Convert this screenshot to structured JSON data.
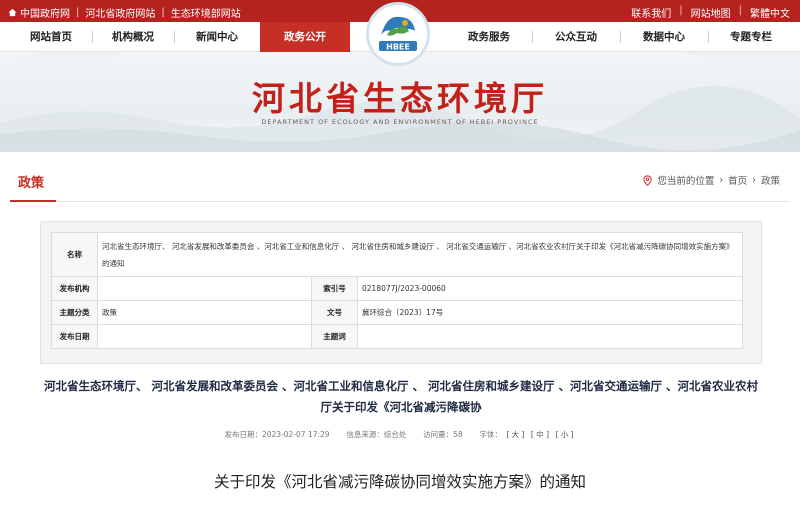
{
  "topbar": {
    "left_links": [
      "中国政府网",
      "河北省政府网站",
      "生态环境部网站"
    ],
    "right_links": [
      "联系我们",
      "网站地图",
      "繁體中文"
    ]
  },
  "nav": {
    "items": [
      "网站首页",
      "机构概况",
      "新闻中心",
      "政务公开",
      "政务服务",
      "公众互动",
      "数据中心",
      "专题专栏"
    ],
    "active": "政务公开"
  },
  "logo": {
    "text": "HBEE"
  },
  "banner": {
    "title": "河北省生态环境厅",
    "subtitle": "DEPARTMENT OF ECOLOGY AND ENVIRONMENT OF HEBEI PROVINCE"
  },
  "section": {
    "title": "政策",
    "crumb_prefix": "您当前的位置",
    "crumbs": [
      "首页",
      "政策"
    ]
  },
  "info": {
    "name_label": "名称",
    "name_value": "河北省生态环境厅、 河北省发展和改革委员会 、河北省工业和信息化厅 、 河北省住房和城乡建设厅 、 河北省交通运输厅 、河北省农业农村厅关于印发《河北省减污降碳协同增效实施方案》的通知",
    "publisher_label": "发布机构",
    "publisher_value": "",
    "index_label": "索引号",
    "index_value": "0218077J/2023-00060",
    "topic_label": "主题分类",
    "topic_value": "政策",
    "docno_label": "文号",
    "docno_value": "冀环综合〔2023〕17号",
    "date_label": "发布日期",
    "date_value": "",
    "keyword_label": "主题词",
    "keyword_value": ""
  },
  "article": {
    "headline": "河北省生态环境厅、 河北省发展和改革委员会 、河北省工业和信息化厅 、 河北省住房和城乡建设厅 、河北省交通运输厅 、河北省农业农村厅关于印发《河北省减污降碳协",
    "date_label": "发布日期：",
    "date": "2023-02-07 17:29",
    "source_label": "信息来源：",
    "source": "综合处",
    "views_label": "访问量：",
    "views": "58",
    "font_label": "字体：",
    "font_sizes": [
      "[ 大 ]",
      "[ 中 ]",
      "[ 小 ]"
    ],
    "doc_title": "关于印发《河北省减污降碳协同增效实施方案》的通知"
  },
  "colors": {
    "brand_red": "#c62f26",
    "topbar_red": "#b5231f",
    "headline_navy": "#1f2a44"
  }
}
